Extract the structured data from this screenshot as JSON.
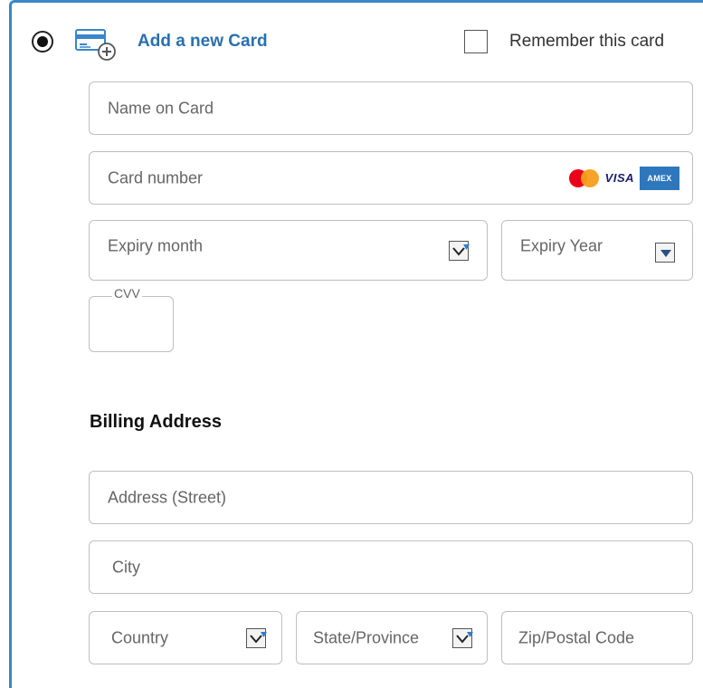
{
  "payment_option": {
    "label": "Add a new Card",
    "selected": true,
    "icon": "credit-card-add-icon",
    "accent_color": "#2a6fb0"
  },
  "remember": {
    "label": "Remember this card",
    "checked": false
  },
  "card_form": {
    "name_placeholder": "Name on Card",
    "number_placeholder": "Card number",
    "brands": [
      "mastercard-logo",
      "VISA",
      "AMEX"
    ],
    "expiry_month_placeholder": "Expiry month",
    "expiry_year_placeholder": "Expiry Year",
    "cvv_label": "CVV"
  },
  "billing": {
    "title": "Billing Address",
    "street_placeholder": "Address (Street)",
    "city_placeholder": "City",
    "country_placeholder": "Country",
    "state_placeholder": "State/Province",
    "zip_placeholder": "Zip/Postal Code"
  }
}
